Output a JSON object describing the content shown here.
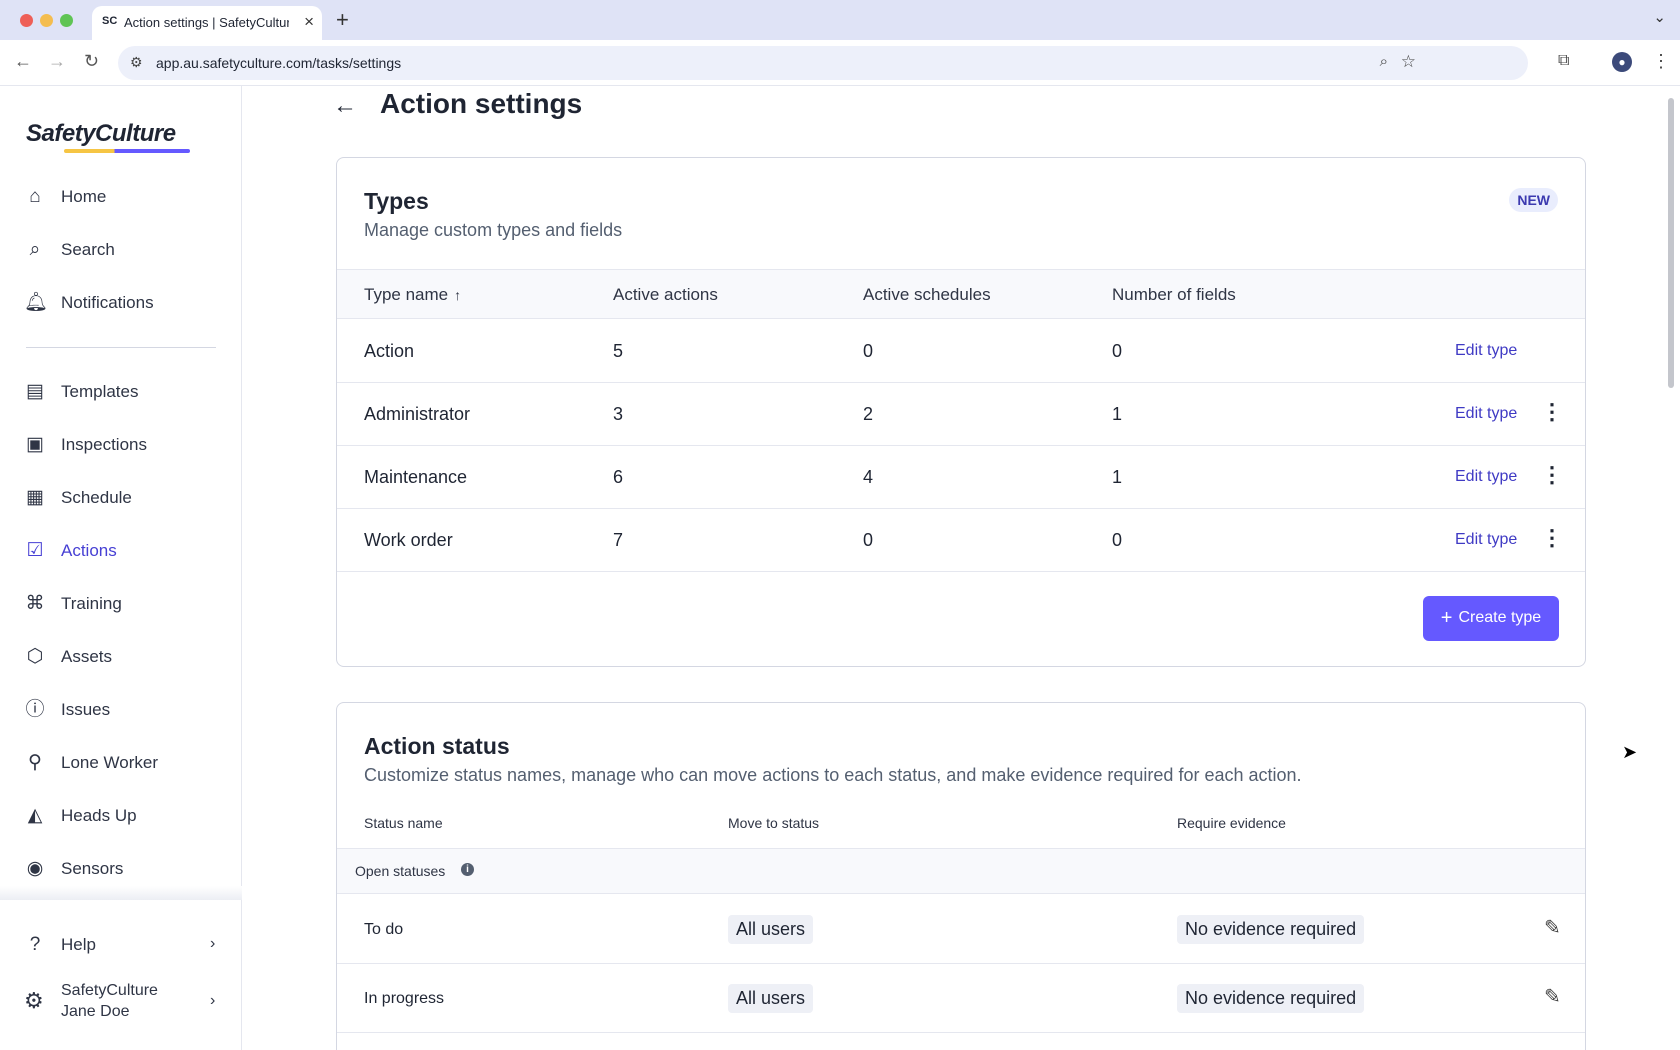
{
  "browser": {
    "tab_title": "Action settings | SafetyCulture",
    "tab_favicon": "SC",
    "url": "app.au.safetyculture.com/tasks/settings"
  },
  "sidebar": {
    "logo": "SafetyCulture",
    "primary_items": [
      {
        "label": "Home",
        "icon": "home-icon"
      },
      {
        "label": "Search",
        "icon": "search-icon"
      },
      {
        "label": "Notifications",
        "icon": "bell-icon"
      }
    ],
    "items": [
      {
        "label": "Templates",
        "icon": "templates-icon"
      },
      {
        "label": "Inspections",
        "icon": "clipboard-icon"
      },
      {
        "label": "Schedule",
        "icon": "calendar-icon"
      },
      {
        "label": "Actions",
        "icon": "actions-icon",
        "active": true
      },
      {
        "label": "Training",
        "icon": "graduation-cap-icon"
      },
      {
        "label": "Assets",
        "icon": "cube-icon"
      },
      {
        "label": "Issues",
        "icon": "alert-icon"
      },
      {
        "label": "Lone Worker",
        "icon": "map-marker-icon"
      },
      {
        "label": "Heads Up",
        "icon": "megaphone-icon"
      },
      {
        "label": "Sensors",
        "icon": "broadcast-icon"
      }
    ],
    "help_label": "Help",
    "org_name": "SafetyCulture",
    "user_name": "Jane Doe"
  },
  "page": {
    "title": "Action settings"
  },
  "types_card": {
    "title": "Types",
    "subtitle": "Manage custom types and fields",
    "badge": "NEW",
    "columns": [
      "Type name",
      "Active actions",
      "Active schedules",
      "Number of fields"
    ],
    "rows": [
      {
        "name": "Action",
        "active_actions": "5",
        "active_schedules": "0",
        "fields": "0",
        "edit": "Edit type",
        "has_menu": false
      },
      {
        "name": "Administrator",
        "active_actions": "3",
        "active_schedules": "2",
        "fields": "1",
        "edit": "Edit type",
        "has_menu": true
      },
      {
        "name": "Maintenance",
        "active_actions": "6",
        "active_schedules": "4",
        "fields": "1",
        "edit": "Edit type",
        "has_menu": true
      },
      {
        "name": "Work order",
        "active_actions": "7",
        "active_schedules": "0",
        "fields": "0",
        "edit": "Edit type",
        "has_menu": true
      }
    ],
    "create_button": "Create type"
  },
  "status_card": {
    "title": "Action status",
    "subtitle": "Customize status names, manage who can move actions to each status, and make evidence required for each action.",
    "columns": [
      "Status name",
      "Move to status",
      "Require evidence"
    ],
    "group_label": "Open statuses",
    "rows": [
      {
        "name": "To do",
        "move_to": "All users",
        "evidence": "No evidence required"
      },
      {
        "name": "In progress",
        "move_to": "All users",
        "evidence": "No evidence required"
      }
    ]
  },
  "colors": {
    "accent": "#6559ff",
    "link": "#3f3ac4",
    "active_nav": "#4740d4"
  }
}
